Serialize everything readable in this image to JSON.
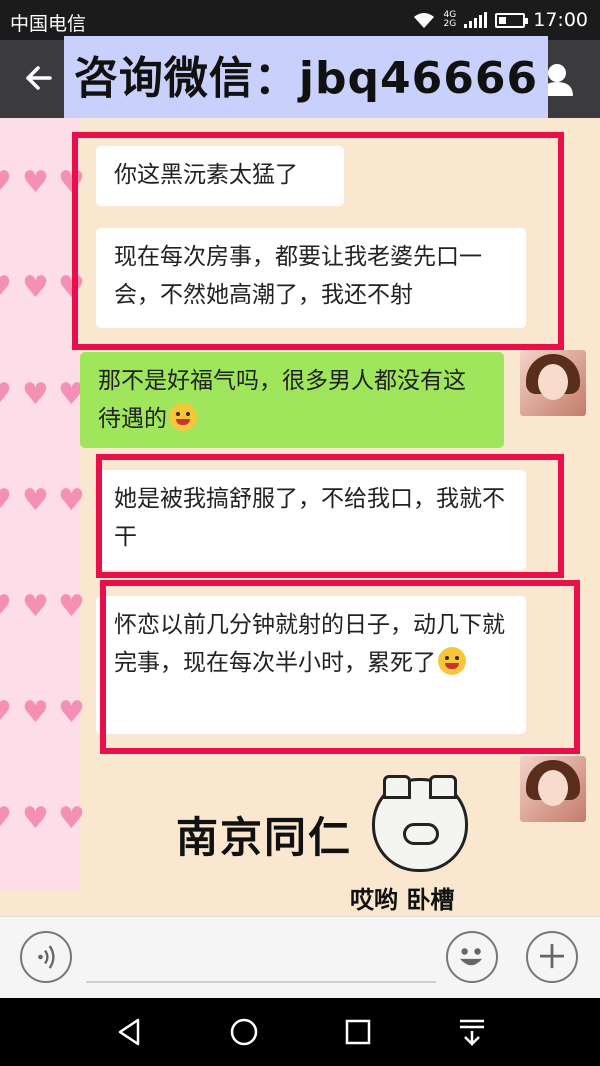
{
  "status_bar": {
    "carrier": "中国电信",
    "network": "4G",
    "network_sub": "2G",
    "time": "17:00",
    "battery_level": 0.25
  },
  "title_bar": {
    "back_icon": "arrow-left-icon",
    "contact_icon": "person-icon"
  },
  "overlay_banner": "咨询微信：jbq46666",
  "messages": [
    {
      "side": "left",
      "text": "你这黑沅素太猛了"
    },
    {
      "side": "left",
      "text": "现在每次房事，都要让我老婆先口一会，不然她高潮了，我还不射"
    },
    {
      "side": "right",
      "text": "那不是好福气吗，很多男人都没有这待遇的",
      "emoji": "winking-tongue-emoji"
    },
    {
      "side": "left",
      "text": "她是被我搞舒服了，不给我口，我就不干"
    },
    {
      "side": "left",
      "text": "怀恋以前几分钟就射的日子，动几下就完事，现在每次半小时，累死了",
      "emoji": "laughing-tears-emoji"
    }
  ],
  "sticker": {
    "main_text": "南京同仁",
    "sub_text": "哎哟 卧槽"
  },
  "colors": {
    "highlight_border": "#e8104a",
    "chat_bg": "#fae7cf",
    "sent_bubble": "#9fe65c",
    "banner_bg": "#c9d0fb"
  }
}
